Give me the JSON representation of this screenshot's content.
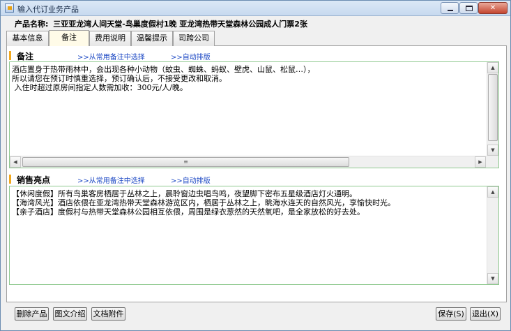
{
  "window": {
    "title": "输入代订业务产品",
    "controls": {
      "minimize": "minimize",
      "maximize": "maximize",
      "close": "✕"
    }
  },
  "product": {
    "label": "产品名称:",
    "name": "三亚亚龙湾人间天堂-鸟巢度假村1晚 亚龙湾热带天堂森林公园成人门票2张"
  },
  "tabs": [
    {
      "label": "基本信息",
      "active": false
    },
    {
      "label": "备注",
      "active": true
    },
    {
      "label": "费用说明",
      "active": false
    },
    {
      "label": "温馨提示",
      "active": false
    },
    {
      "label": "司跨公司",
      "active": false
    }
  ],
  "remarks": {
    "title": "备注",
    "link_select": ">>从常用备注中选择",
    "link_auto": ">>自动排版",
    "text": "酒店置身于热带雨林中，会出现各种小动物（蚊虫、蜘蛛、蚂蚁、壁虎、山鼠、松鼠…），\n所以请您在预订时慎重选择，预订确认后，不接受更改和取消。\n 入住时超过原房间指定人数需加收：300元/人/晚。"
  },
  "highlights": {
    "title": "销售亮点",
    "link_select": ">>从常用备注中选择",
    "link_auto": ">>自动排版",
    "text": "【休闲度假】所有鸟巢客房栖居于丛林之上，晨聆窗边虫唱鸟鸣，夜望脚下密布五星级酒店灯火通明。\n【海湾风光】酒店依偎在亚龙湾热带天堂森林游览区内，栖居于丛林之上，眺海水连天的自然风光，享愉快时光。\n【亲子酒店】度假村与热带天堂森林公园相互依偎，周围是绿衣葱然的天然氧吧，是全家放松的好去处。"
  },
  "buttons": {
    "delete": "删除产品",
    "illustrated": "图文介绍",
    "attachment": "文档附件",
    "save": "保存(S)",
    "exit": "退出(X)"
  },
  "colors": {
    "section_accent": "#f2a81d",
    "link": "#1c48c4",
    "textbox_border": "#8fc98f"
  }
}
